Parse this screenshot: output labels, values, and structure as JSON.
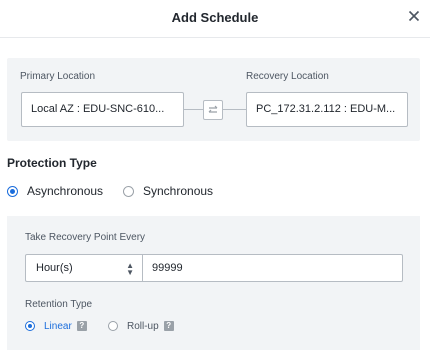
{
  "dialog": {
    "title": "Add Schedule"
  },
  "locations": {
    "primary_label": "Primary Location",
    "primary_value": "Local AZ : EDU-SNC-610...",
    "recovery_label": "Recovery Location",
    "recovery_value": "PC_172.31.2.112 : EDU-M..."
  },
  "protection": {
    "title": "Protection Type",
    "options": [
      {
        "label": "Asynchronous",
        "selected": true
      },
      {
        "label": "Synchronous",
        "selected": false
      }
    ]
  },
  "schedule": {
    "interval_label": "Take Recovery Point Every",
    "unit": "Hour(s)",
    "value": "99999",
    "retention_label": "Retention Type",
    "retention_options": [
      {
        "label": "Linear",
        "selected": true
      },
      {
        "label": "Roll-up",
        "selected": false
      }
    ]
  },
  "colors": {
    "accent": "#1b6ddc",
    "panel": "#f2f4f6",
    "border": "#b6bcc3"
  }
}
